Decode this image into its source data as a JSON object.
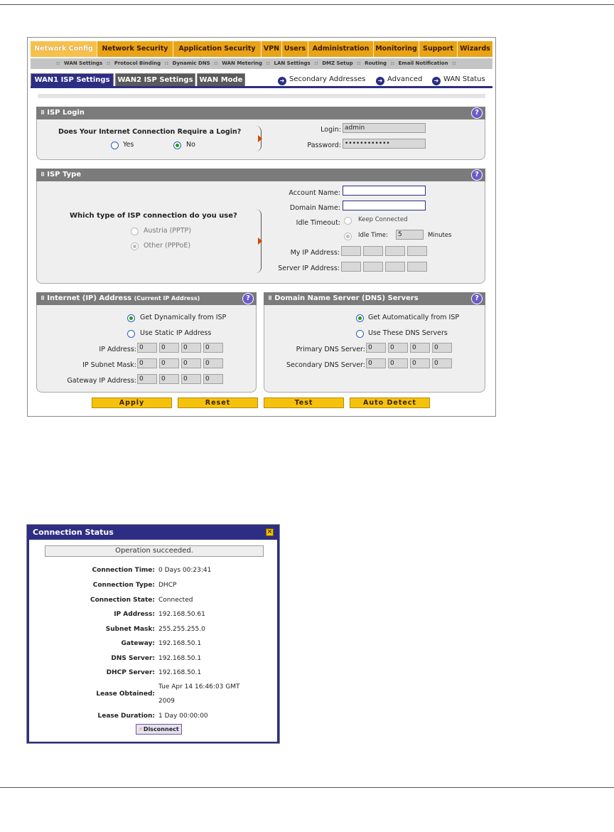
{
  "top_nav": [
    {
      "label": "Network Config",
      "active": true
    },
    {
      "label": "Network Security"
    },
    {
      "label": "Application Security"
    },
    {
      "label": "VPN"
    },
    {
      "label": "Users"
    },
    {
      "label": "Administration"
    },
    {
      "label": "Monitoring"
    },
    {
      "label": "Support"
    },
    {
      "label": "Wizards"
    }
  ],
  "sub_nav": [
    "WAN Settings",
    "Protocol Binding",
    "Dynamic DNS",
    "WAN Metering",
    "LAN Settings",
    "DMZ Setup",
    "Routing",
    "Email Notification"
  ],
  "sub_nav_sep": "::",
  "tabs": [
    "WAN1 ISP Settings",
    "WAN2 ISP Settings",
    "WAN Mode"
  ],
  "right_links": [
    "Secondary Addresses",
    "Advanced",
    "WAN Status"
  ],
  "help_glyph": "?",
  "grip_glyph": "⠿",
  "isp_login": {
    "title": "ISP Login",
    "question": "Does Your Internet Connection Require a Login?",
    "yes": "Yes",
    "no": "No",
    "login_label": "Login:",
    "login_value": "admin",
    "password_label": "Password:",
    "password_value": "••••••••••••"
  },
  "isp_type": {
    "title": "ISP Type",
    "question": "Which type of ISP connection do you use?",
    "austria": "Austria (PPTP)",
    "other": "Other (PPPoE)",
    "account_name": "Account Name:",
    "domain_name": "Domain Name:",
    "idle_timeout": "Idle Timeout:",
    "keep_connected": "Keep Connected",
    "idle_time": "Idle Time:",
    "idle_time_value": "5",
    "minutes": "Minutes",
    "my_ip": "My IP Address:",
    "server_ip": "Server IP Address:"
  },
  "internet_ip": {
    "title": "Internet (IP) Address",
    "subtitle": "(Current IP Address)",
    "get_dynamic": "Get Dynamically from ISP",
    "use_static": "Use Static IP Address",
    "ip_address": "IP Address:",
    "subnet_mask": "IP Subnet Mask:",
    "gateway": "Gateway IP Address:",
    "octet": "0"
  },
  "dns": {
    "title": "Domain Name Server (DNS) Servers",
    "get_auto": "Get Automatically from ISP",
    "use_these": "Use These DNS Servers",
    "primary": "Primary DNS Server:",
    "secondary": "Secondary DNS Server:",
    "octet": "0"
  },
  "buttons": [
    "Apply",
    "Reset",
    "Test",
    "Auto Detect"
  ],
  "connection_status": {
    "title": "Connection Status",
    "close_glyph": "×",
    "message": "Operation succeeded.",
    "rows": [
      {
        "label": "Connection Time:",
        "value": "0 Days 00:23:41"
      },
      {
        "label": "Connection Type:",
        "value": "DHCP"
      },
      {
        "label": "Connection State:",
        "value": "Connected"
      },
      {
        "label": "IP Address:",
        "value": "192.168.50.61"
      },
      {
        "label": "Subnet Mask:",
        "value": "255.255.255.0"
      },
      {
        "label": "Gateway:",
        "value": "192.168.50.1"
      },
      {
        "label": "DNS Server:",
        "value": "192.168.50.1"
      },
      {
        "label": "DHCP Server:",
        "value": "192.168.50.1"
      }
    ],
    "lease_obtained_label": "Lease Obtained:",
    "lease_obtained_line1": "Tue Apr 14 16:46:03 GMT",
    "lease_obtained_line2": "2009",
    "lease_duration_label": "Lease Duration:",
    "lease_duration_value": "1 Day 00:00:00",
    "disconnect": "Disconnect",
    "disconnect_icon": "lightning-icon"
  },
  "colors": {
    "nav_orange": "#e8a317",
    "accent_blue": "#2d2e83",
    "button_yellow": "#f4c20d",
    "section_gray": "#7b7b7b"
  }
}
